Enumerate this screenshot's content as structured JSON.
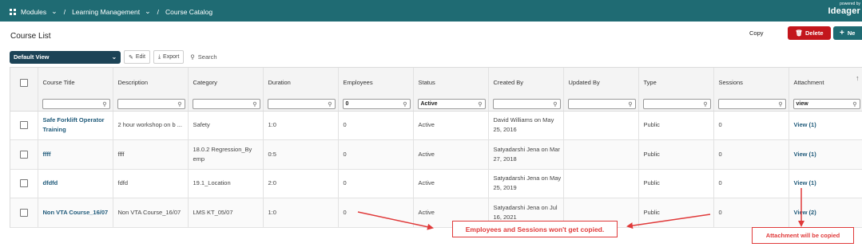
{
  "topbar": {
    "modules_label": "Modules",
    "sep1": "/",
    "learning_label": "Learning Management",
    "sep2": "/",
    "catalog_label": "Course Catalog",
    "powered_by": "powered by",
    "brand": "Ideager"
  },
  "page": {
    "title": "Course List"
  },
  "actions": {
    "copy": "Copy",
    "delete": "Delete",
    "new": "Ne"
  },
  "toolbar": {
    "view": "Default View",
    "edit": "Edit",
    "export": "Export",
    "search_placeholder": "Search"
  },
  "columns": [
    "Course Title",
    "Description",
    "Category",
    "Duration",
    "Employees",
    "Status",
    "Created By",
    "Updated By",
    "Type",
    "Sessions",
    "Attachment"
  ],
  "filters": [
    "",
    "",
    "",
    "",
    "0",
    "Active",
    "",
    "",
    "",
    "",
    "view"
  ],
  "rows": [
    [
      "Safe Forklift Operator Training",
      "2 hour workshop on b ...",
      "Safety",
      "1:0",
      "0",
      "Active",
      "David Williams on May 25, 2016",
      "",
      "Public",
      "0",
      "View (1)"
    ],
    [
      "ffff",
      "ffff",
      "18.0.2 Regression_By emp",
      "0:5",
      "0",
      "Active",
      "Satyadarshi Jena on Mar 27, 2018",
      "",
      "Public",
      "0",
      "View (1)"
    ],
    [
      "dfdfd",
      "fdfd",
      "19.1_Location",
      "2:0",
      "0",
      "Active",
      "Satyadarshi Jena on May 25, 2019",
      "",
      "Public",
      "0",
      "View (1)"
    ],
    [
      "Non VTA Course_16/07",
      "Non VTA Course_16/07",
      "LMS KT_05/07",
      "1:0",
      "0",
      "Active",
      "Satyadarshi Jena on Jul 16, 2021",
      "",
      "Public",
      "0",
      "View (2)"
    ]
  ],
  "annotations": {
    "employees_sessions": "Employees and Sessions won't get copied.",
    "attachment": "Attachment will be copied"
  },
  "colors": {
    "header": "#1f6b73",
    "delete": "#c3161c",
    "annotation": "#e03a3a",
    "view_select": "#1c4356"
  }
}
